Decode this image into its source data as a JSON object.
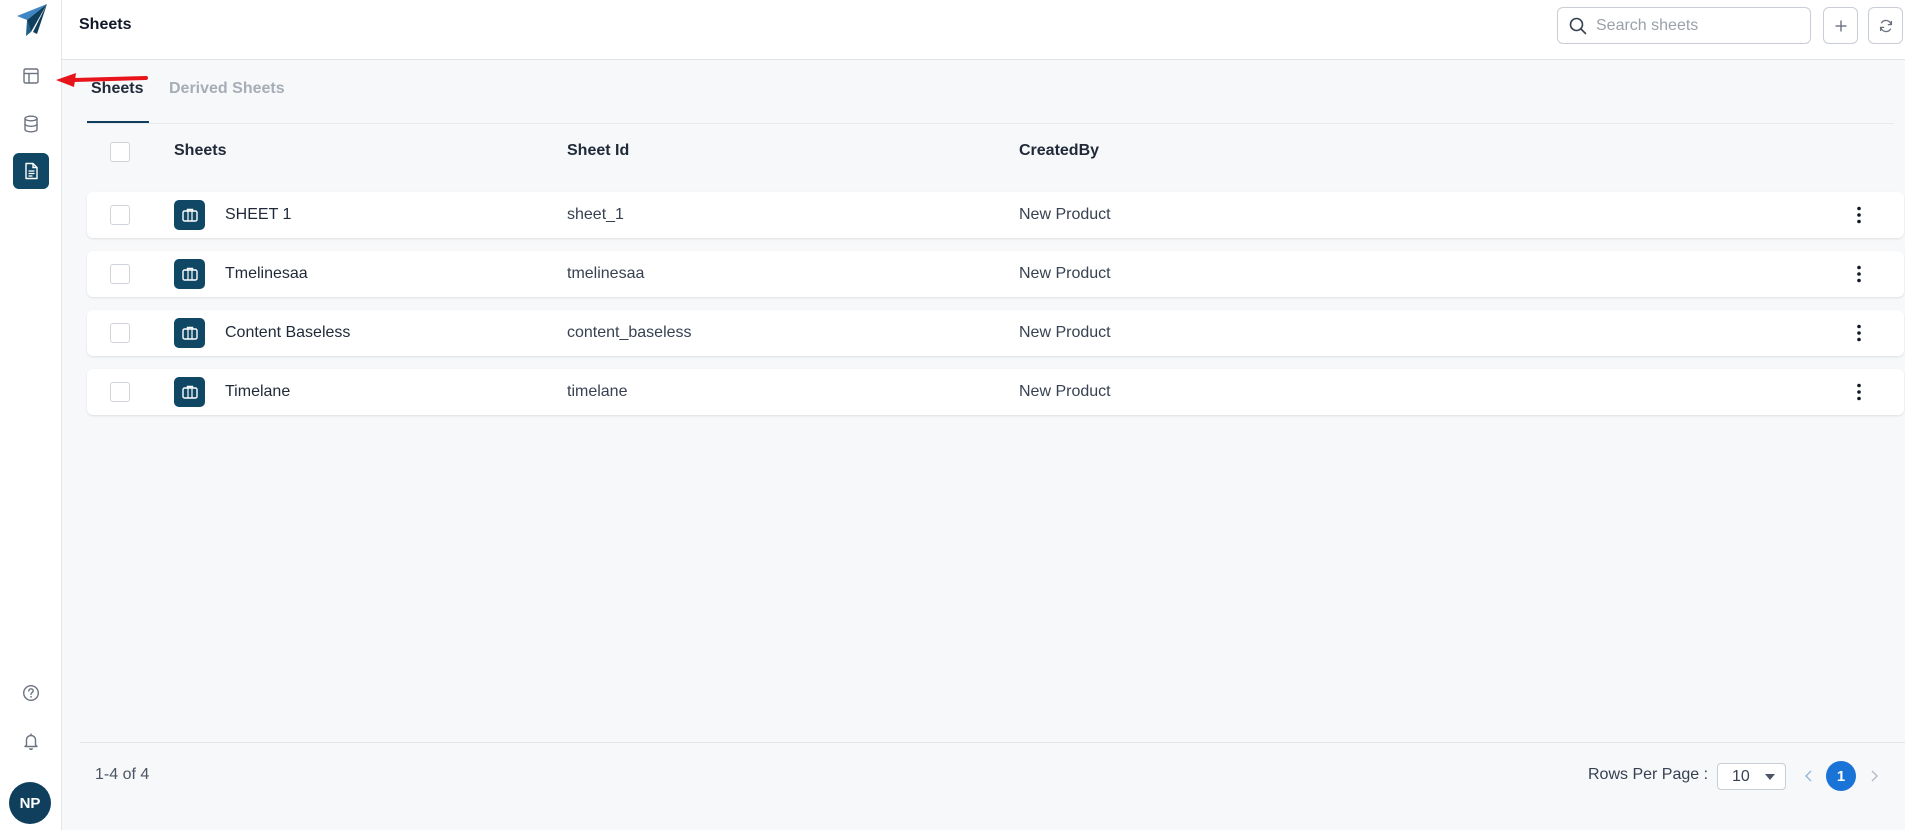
{
  "header": {
    "title": "Sheets",
    "search_placeholder": "Search sheets",
    "add_icon": "plus-icon",
    "refresh_icon": "refresh-icon"
  },
  "sidebar": {
    "items": [
      {
        "icon": "layout-icon",
        "active": false
      },
      {
        "icon": "database-icon",
        "active": false
      },
      {
        "icon": "document-icon",
        "active": true
      },
      {
        "icon": "help-icon",
        "active": false
      },
      {
        "icon": "bell-icon",
        "active": false
      }
    ],
    "avatar_initials": "NP"
  },
  "tabs": [
    {
      "label": "Sheets",
      "active": true
    },
    {
      "label": "Derived Sheets",
      "active": false
    }
  ],
  "table": {
    "columns": [
      "Sheets",
      "Sheet Id",
      "CreatedBy"
    ],
    "rows": [
      {
        "name": "SHEET 1",
        "sheet_id": "sheet_1",
        "created_by": "New Product"
      },
      {
        "name": "Tmelinesaa",
        "sheet_id": "tmelinesaa",
        "created_by": "New Product"
      },
      {
        "name": "Content Baseless",
        "sheet_id": "content_baseless",
        "created_by": "New Product"
      },
      {
        "name": "Timelane",
        "sheet_id": "timelane",
        "created_by": "New Product"
      }
    ]
  },
  "footer": {
    "range": "1-4 of 4",
    "rows_per_page_label": "Rows Per Page :",
    "rows_per_page_value": "10",
    "current_page": "1"
  },
  "colors": {
    "primary": "#0f4764",
    "page_active": "#1a73d6",
    "annotation_arrow": "#e8141b"
  }
}
